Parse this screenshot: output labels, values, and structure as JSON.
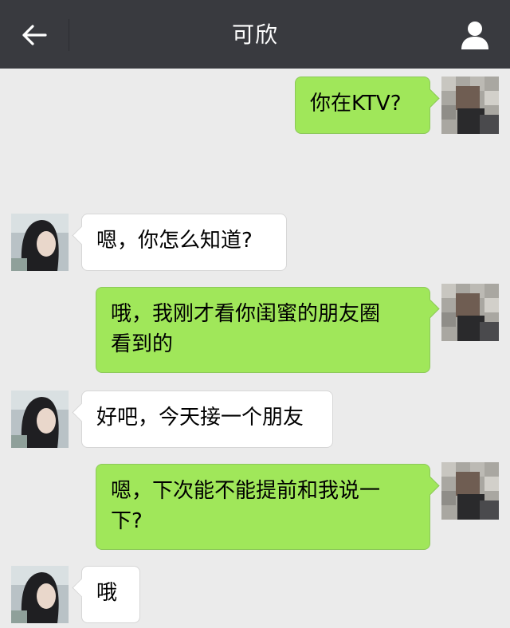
{
  "header": {
    "title": "可欣",
    "back_icon": "arrow-left-icon",
    "profile_icon": "person-icon"
  },
  "colors": {
    "header_bg": "#393a3f",
    "chat_bg": "#ebebeb",
    "my_bubble": "#a0e75a",
    "their_bubble": "#ffffff"
  },
  "messages": [
    {
      "sender": "me",
      "text": "你在KTV?"
    },
    {
      "sender": "them",
      "text": "嗯，你怎么知道?"
    },
    {
      "sender": "me",
      "text": "哦，我刚才看你闺蜜的朋友圈\n看到的"
    },
    {
      "sender": "them",
      "text": "好吧，今天接一个朋友"
    },
    {
      "sender": "me",
      "text": "嗯，下次能不能提前和我说一\n下?"
    },
    {
      "sender": "them",
      "text": "哦"
    }
  ]
}
